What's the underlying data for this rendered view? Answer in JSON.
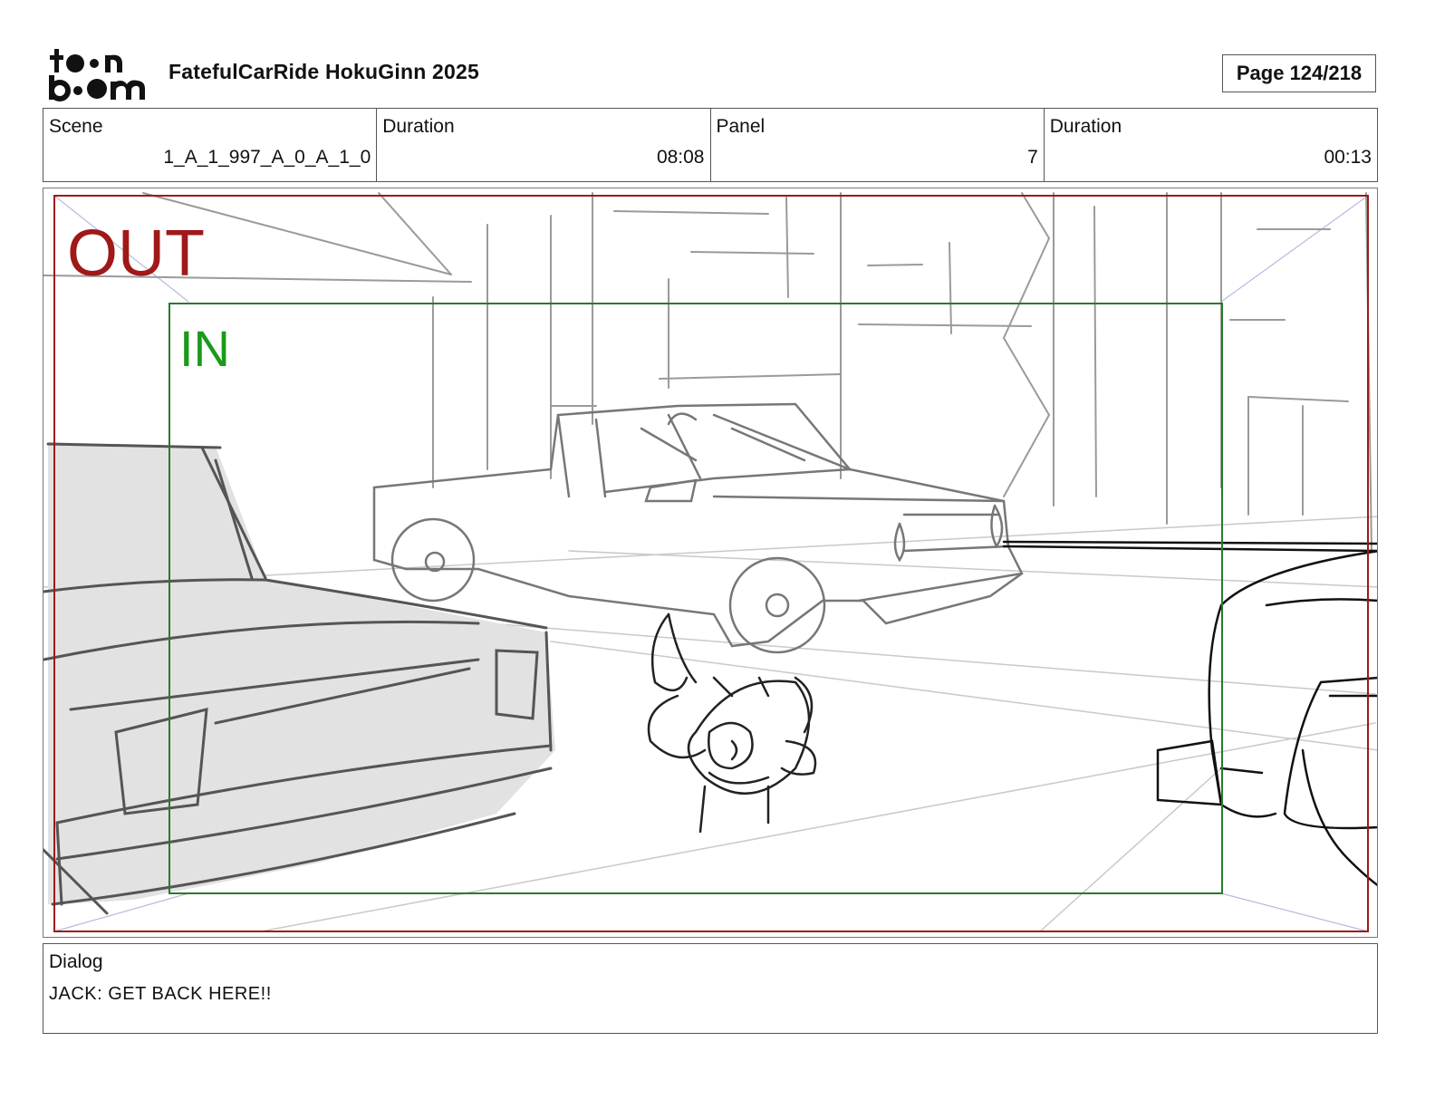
{
  "header": {
    "logo_text": "toon boom",
    "title": "FatefulCarRide HokuGinn 2025",
    "page": "Page 124/218"
  },
  "info": {
    "scene_label": "Scene",
    "scene_value": "1_A_1_997_A_0_A_1_0",
    "scene_duration_label": "Duration",
    "scene_duration_value": "08:08",
    "panel_label": "Panel",
    "panel_value": "7",
    "panel_duration_label": "Duration",
    "panel_duration_value": "00:13"
  },
  "frame": {
    "out_label": "OUT",
    "in_label": "IN",
    "out_color": "#a01818",
    "in_color": "#1a9a1a"
  },
  "dialog": {
    "label": "Dialog",
    "text": "JACK: GET BACK HERE!!"
  }
}
